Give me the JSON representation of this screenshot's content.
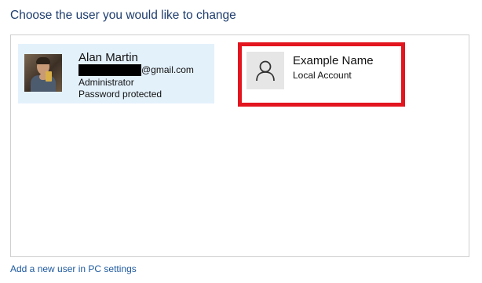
{
  "heading": "Choose the user you would like to change",
  "users": [
    {
      "name": "Alan Martin",
      "email_domain": "@gmail.com",
      "role": "Administrator",
      "status": "Password protected",
      "selected": true
    },
    {
      "name": "Example Name",
      "account_type": "Local Account",
      "highlight_color": "#e3151f"
    }
  ],
  "footer": {
    "add_user_link": "Add a new user in PC settings"
  },
  "colors": {
    "heading": "#1e3d6e",
    "selected_tile": "#e3f1fb",
    "link": "#1e5aa0"
  }
}
